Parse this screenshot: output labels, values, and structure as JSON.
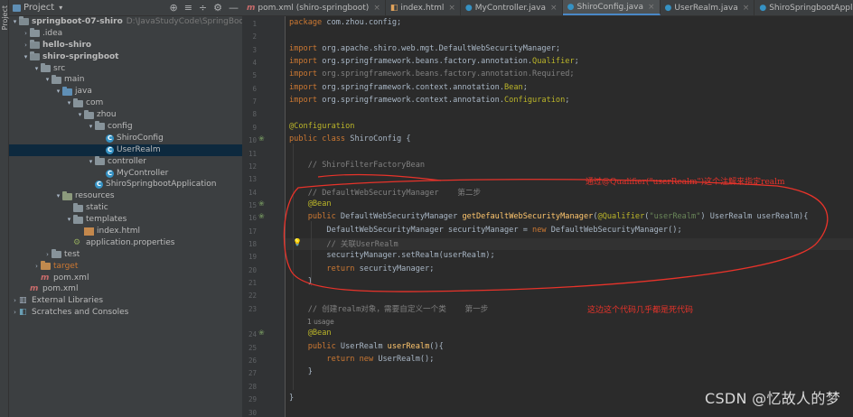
{
  "sidebar_strip": {
    "label": "Project"
  },
  "project_panel": {
    "title": "Project",
    "tools": [
      "⊕",
      "≡",
      "÷",
      "⚙",
      "—"
    ],
    "tree": [
      {
        "indent": 0,
        "arrow": "▾",
        "icon": "module",
        "label": "springboot-07-shiro",
        "bold": true,
        "path": "D:\\JavaStudyCode\\SpringBoot\\springbo"
      },
      {
        "indent": 1,
        "arrow": "›",
        "icon": "folder",
        "label": ".idea"
      },
      {
        "indent": 1,
        "arrow": "›",
        "icon": "module",
        "label": "hello-shiro",
        "bold": true
      },
      {
        "indent": 1,
        "arrow": "▾",
        "icon": "module",
        "label": "shiro-springboot",
        "bold": true
      },
      {
        "indent": 2,
        "arrow": "▾",
        "icon": "folder",
        "label": "src"
      },
      {
        "indent": 3,
        "arrow": "▾",
        "icon": "folder",
        "label": "main"
      },
      {
        "indent": 4,
        "arrow": "▾",
        "icon": "blue",
        "label": "java"
      },
      {
        "indent": 5,
        "arrow": "▾",
        "icon": "folder",
        "label": "com"
      },
      {
        "indent": 6,
        "arrow": "▾",
        "icon": "folder",
        "label": "zhou"
      },
      {
        "indent": 7,
        "arrow": "▾",
        "icon": "folder",
        "label": "config"
      },
      {
        "indent": 8,
        "arrow": "",
        "icon": "class",
        "label": "ShiroConfig"
      },
      {
        "indent": 8,
        "arrow": "",
        "icon": "class",
        "label": "UserRealm",
        "selected": true
      },
      {
        "indent": 7,
        "arrow": "▾",
        "icon": "folder",
        "label": "controller"
      },
      {
        "indent": 8,
        "arrow": "",
        "icon": "class",
        "label": "MyController"
      },
      {
        "indent": 7,
        "arrow": "",
        "icon": "class",
        "label": "ShiroSpringbootApplication"
      },
      {
        "indent": 4,
        "arrow": "▾",
        "icon": "res",
        "label": "resources"
      },
      {
        "indent": 5,
        "arrow": "",
        "icon": "folder",
        "label": "static"
      },
      {
        "indent": 5,
        "arrow": "▾",
        "icon": "folder",
        "label": "templates"
      },
      {
        "indent": 6,
        "arrow": "",
        "icon": "html",
        "label": "index.html"
      },
      {
        "indent": 5,
        "arrow": "",
        "icon": "props",
        "label": "application.properties"
      },
      {
        "indent": 3,
        "arrow": "›",
        "icon": "folder",
        "label": "test"
      },
      {
        "indent": 2,
        "arrow": "›",
        "icon": "orange",
        "label": "target",
        "target": true
      },
      {
        "indent": 2,
        "arrow": "",
        "icon": "mvn",
        "label": "pom.xml"
      },
      {
        "indent": 1,
        "arrow": "",
        "icon": "mvn",
        "label": "pom.xml"
      },
      {
        "indent": 0,
        "arrow": "›",
        "icon": "lib",
        "label": "External Libraries"
      },
      {
        "indent": 0,
        "arrow": "›",
        "icon": "scratch",
        "label": "Scratches and Consoles"
      }
    ]
  },
  "tabs": [
    {
      "icon": "m",
      "glyph": "m",
      "label": "pom.xml (shiro-springboot)"
    },
    {
      "icon": "h",
      "glyph": "◧",
      "label": "index.html"
    },
    {
      "icon": "c",
      "glyph": "●",
      "label": "MyController.java"
    },
    {
      "icon": "c",
      "glyph": "●",
      "label": "ShiroConfig.java",
      "active": true
    },
    {
      "icon": "c",
      "glyph": "●",
      "label": "UserRealm.java"
    },
    {
      "icon": "c",
      "glyph": "●",
      "label": "ShiroSpringbootApplication.java"
    }
  ],
  "line_numbers": [
    "1",
    "2",
    "3",
    "4",
    "5",
    "6",
    "7",
    "8",
    "9",
    "10",
    "11",
    "12",
    "13",
    "14",
    "15",
    "16",
    "17",
    "18",
    "19",
    "20",
    "21",
    "22",
    "23",
    "24",
    "25",
    "26",
    "27",
    "28",
    "29",
    "30"
  ],
  "code": [
    [
      [
        "kw",
        "package "
      ],
      [
        "",
        "com.zhou.config;"
      ]
    ],
    [],
    [
      [
        "kw",
        "import "
      ],
      [
        "",
        "org.apache.shiro.web.mgt.DefaultWebSecurityManager;"
      ]
    ],
    [
      [
        "kw",
        "import "
      ],
      [
        "",
        "org.springframework.beans.factory.annotation."
      ],
      [
        "ann",
        "Qualifier"
      ],
      [
        "",
        ";"
      ]
    ],
    [
      [
        "kw",
        "import "
      ],
      [
        "cmt",
        "org.springframework.beans.factory.annotation.Required;"
      ]
    ],
    [
      [
        "kw",
        "import "
      ],
      [
        "",
        "org.springframework.context.annotation."
      ],
      [
        "ann",
        "Bean"
      ],
      [
        "",
        ";"
      ]
    ],
    [
      [
        "kw",
        "import "
      ],
      [
        "",
        "org.springframework.context.annotation."
      ],
      [
        "ann",
        "Configuration"
      ],
      [
        "",
        ";"
      ]
    ],
    [],
    [
      [
        "ann",
        "@Configuration"
      ]
    ],
    [
      [
        "kw",
        "public class "
      ],
      [
        "",
        "ShiroConfig {"
      ]
    ],
    [],
    [
      [
        "cmt",
        "    // ShiroFilterFactoryBean"
      ]
    ],
    [],
    [
      [
        "cmt",
        "    // DefaultWebSecurityManager    第二步"
      ]
    ],
    [
      [
        "ann",
        "    @Bean"
      ]
    ],
    [
      [
        "kw",
        "    public "
      ],
      [
        "",
        "DefaultWebSecurityManager "
      ],
      [
        "fn",
        "getDefaultWebSecurityManager"
      ],
      [
        "",
        "("
      ],
      [
        "ann",
        "@Qualifier"
      ],
      [
        "",
        "("
      ],
      [
        "str",
        "\"userRealm\""
      ],
      [
        "",
        ") UserRealm userRealm){"
      ]
    ],
    [
      [
        "",
        "        DefaultWebSecurityManager securityManager = "
      ],
      [
        "kw",
        "new "
      ],
      [
        "",
        "DefaultWebSecurityManager();"
      ]
    ],
    [
      [
        "cmt",
        "        // 关联UserRealm"
      ]
    ],
    [
      [
        "",
        "        securityManager.setRealm(userRealm);"
      ]
    ],
    [
      [
        "kw",
        "        return "
      ],
      [
        "",
        "securityManager;"
      ]
    ],
    [
      [
        "",
        "    }"
      ]
    ],
    [],
    [
      [
        "cmt",
        "    // 创建realm对象，需要自定义一个类    第一步"
      ]
    ],
    [
      [
        "ann",
        "    @Bean"
      ]
    ],
    [
      [
        "kw",
        "    public "
      ],
      [
        "",
        "UserRealm "
      ],
      [
        "fn",
        "userRealm"
      ],
      [
        "",
        "(){"
      ]
    ],
    [
      [
        "kw",
        "        return new "
      ],
      [
        "",
        "UserRealm();"
      ]
    ],
    [
      [
        "",
        "    }"
      ]
    ],
    [],
    [
      [
        "",
        "}"
      ]
    ],
    []
  ],
  "usage_hint": "1 usage",
  "annotations": {
    "note1": "通过@Qualifier(\"userRealm\")这个注解来指定realm",
    "note2": "这边这个代码几乎都是死代码"
  },
  "watermark": "CSDN @忆故人的梦",
  "colors": {
    "annotation_red": "#e8332a",
    "accent": "#4a88c7"
  }
}
